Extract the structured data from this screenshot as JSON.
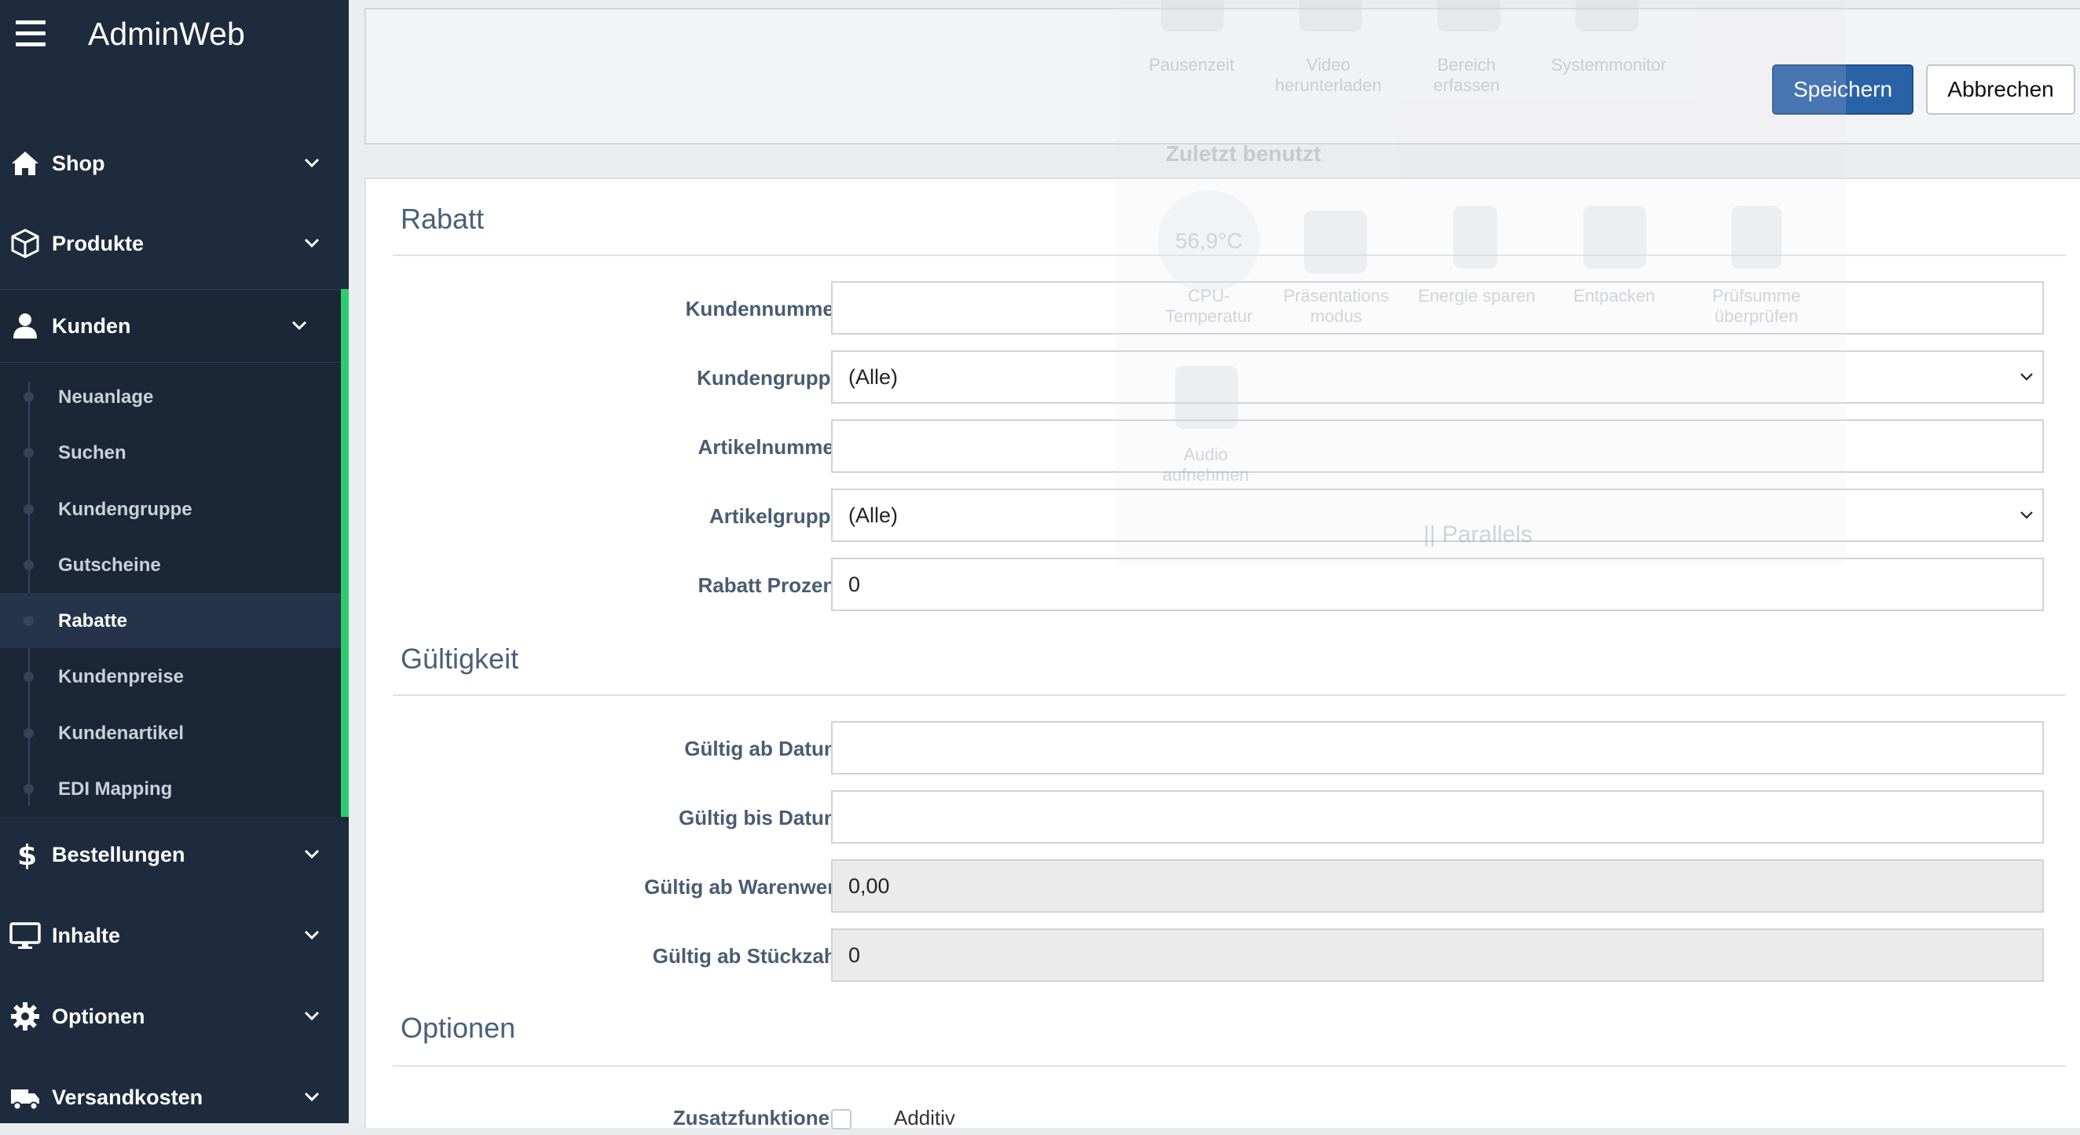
{
  "app": {
    "title": "AdminWeb"
  },
  "sidebar": {
    "items": [
      {
        "label": "Shop",
        "icon": "home-icon"
      },
      {
        "label": "Produkte",
        "icon": "box-icon"
      },
      {
        "label": "Kunden",
        "icon": "user-icon",
        "expanded": true
      },
      {
        "label": "Bestellungen",
        "icon": "dollar-icon"
      },
      {
        "label": "Inhalte",
        "icon": "monitor-icon"
      },
      {
        "label": "Optionen",
        "icon": "gear-icon"
      },
      {
        "label": "Versandkosten",
        "icon": "truck-icon"
      }
    ],
    "kunden_sub": [
      {
        "label": "Neuanlage"
      },
      {
        "label": "Suchen"
      },
      {
        "label": "Kundengruppe"
      },
      {
        "label": "Gutscheine"
      },
      {
        "label": "Rabatte",
        "active": true
      },
      {
        "label": "Kundenpreise"
      },
      {
        "label": "Kundenartikel"
      },
      {
        "label": "EDI Mapping"
      }
    ],
    "accent_color": "#2ecc71"
  },
  "toolbar": {
    "save_label": "Speichern",
    "cancel_label": "Abbrechen"
  },
  "form": {
    "sections": {
      "rabatt": "Rabatt",
      "gueltigkeit": "Gültigkeit",
      "optionen": "Optionen"
    },
    "fields": {
      "kundennummer": {
        "label": "Kundennummer",
        "value": ""
      },
      "kundengruppe": {
        "label": "Kundengruppe",
        "value": "(Alle)"
      },
      "artikelnummer": {
        "label": "Artikelnummer",
        "value": ""
      },
      "artikelgruppe": {
        "label": "Artikelgruppe",
        "value": "(Alle)"
      },
      "rabatt_prozent": {
        "label": "Rabatt Prozent",
        "value": "0"
      },
      "gueltig_ab_datum": {
        "label": "Gültig ab Datum",
        "value": ""
      },
      "gueltig_bis_datum": {
        "label": "Gültig bis Datum",
        "value": ""
      },
      "gueltig_ab_warenwert": {
        "label": "Gültig ab Warenwert",
        "value": "0,00"
      },
      "gueltig_ab_stueckzahl": {
        "label": "Gültig ab Stückzahl",
        "value": "0"
      },
      "zusatzfunktionen": {
        "label": "Zusatzfunktionen",
        "option": "Additiv",
        "checked": false
      }
    }
  },
  "overlay": {
    "tools": [
      {
        "label": "Pausenzeit"
      },
      {
        "label": "Video herunterladen"
      },
      {
        "label": "Bereich erfassen"
      },
      {
        "label": "Systemmonitor"
      },
      {
        "label": "CPU-Temperatur"
      },
      {
        "label": "Präsentations modus"
      },
      {
        "label": "Energie sparen"
      },
      {
        "label": "Entpacken"
      },
      {
        "label": "Prüfsumme überprüfen"
      },
      {
        "label": "Audio aufnehmen"
      }
    ],
    "recent_title": "Zuletzt benutzt",
    "cpu_temp": "56,9°C",
    "brand": "|| Parallels"
  },
  "colors": {
    "sidebar_bg": "#1e2b3d",
    "primary_button": "#2a62a8",
    "section_title": "#4a6078"
  }
}
